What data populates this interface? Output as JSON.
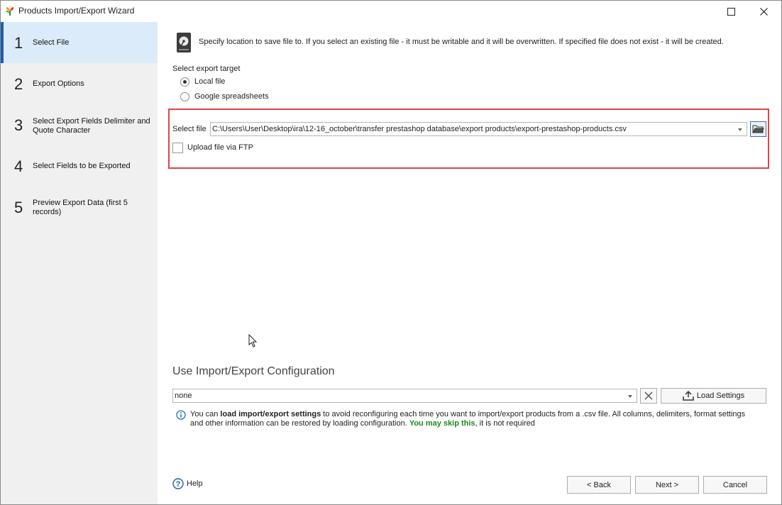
{
  "window": {
    "title": "Products Import/Export Wizard"
  },
  "sidebar": {
    "steps": [
      {
        "num": "1",
        "label": "Select File",
        "active": true
      },
      {
        "num": "2",
        "label": "Export Options"
      },
      {
        "num": "3",
        "label": "Select Export Fields Delimiter and Quote Character"
      },
      {
        "num": "4",
        "label": "Select Fields to be Exported"
      },
      {
        "num": "5",
        "label": "Preview Export Data (first 5 records)"
      }
    ]
  },
  "main": {
    "info_text": "Specify location to save file to. If you select an existing file - it must be writable and it will be overwritten. If specified file does not exist - it will be created.",
    "export_target_label": "Select export target",
    "radio_local": "Local file",
    "radio_google": "Google spreadsheets",
    "select_file_label": "Select file",
    "file_path": "C:\\Users\\User\\Desktop\\ira\\12-16_october\\transfer prestashop database\\export products\\export-prestashop-products.csv",
    "upload_ftp_label": "Upload file via FTP",
    "config_heading": "Use Import/Export Configuration",
    "config_value": "none",
    "load_settings_label": "Load Settings",
    "hint": {
      "p1": "You can ",
      "bold": "load import/export settings",
      "p2": " to avoid reconfiguring each time you want to import/export products from a .csv file. All columns, delimiters, format settings",
      "line2": "and other information can be restored by loading configuration. ",
      "green": "You may skip this",
      "p3": ", it is not required"
    },
    "help_label": "Help",
    "back_label": "< Back",
    "next_label": "Next >",
    "cancel_label": "Cancel"
  },
  "colors": {
    "accent": "#1e5fa6",
    "highlight_border": "#e04545",
    "skip_green": "#1a8a1a",
    "active_step_bg": "#dcebfa"
  }
}
